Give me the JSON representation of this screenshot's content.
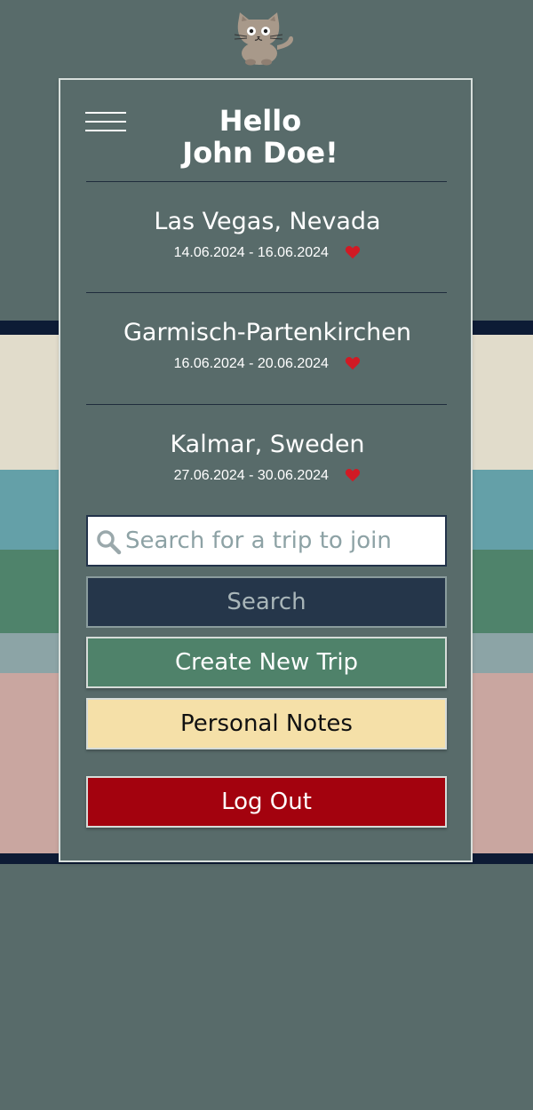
{
  "greeting": {
    "line1": "Hello",
    "line2": "John Doe!"
  },
  "menu": {
    "icon": "hamburger-menu-icon"
  },
  "logo": {
    "icon": "cat-logo-icon"
  },
  "trips": [
    {
      "name": "Las Vegas, Nevada",
      "dates": "14.06.2024 - 16.06.2024",
      "icon": "heart-icon"
    },
    {
      "name": "Garmisch-Partenkirchen",
      "dates": "16.06.2024 - 20.06.2024",
      "icon": "heart-icon"
    },
    {
      "name": "Kalmar, Sweden",
      "dates": "27.06.2024 - 30.06.2024",
      "icon": "heart-icon"
    }
  ],
  "search": {
    "placeholder": "Search for a trip to join",
    "value": "",
    "button_label": "Search",
    "icon": "search-icon"
  },
  "buttons": {
    "create_trip": "Create New Trip",
    "personal_notes": "Personal Notes",
    "log_out": "Log Out"
  },
  "colors": {
    "background": "#586b6a",
    "search_button": "#25364a",
    "create_button": "#4f826a",
    "notes_button": "#f5e0a8",
    "logout_button": "#a3020e",
    "heart": "#d11a24"
  }
}
